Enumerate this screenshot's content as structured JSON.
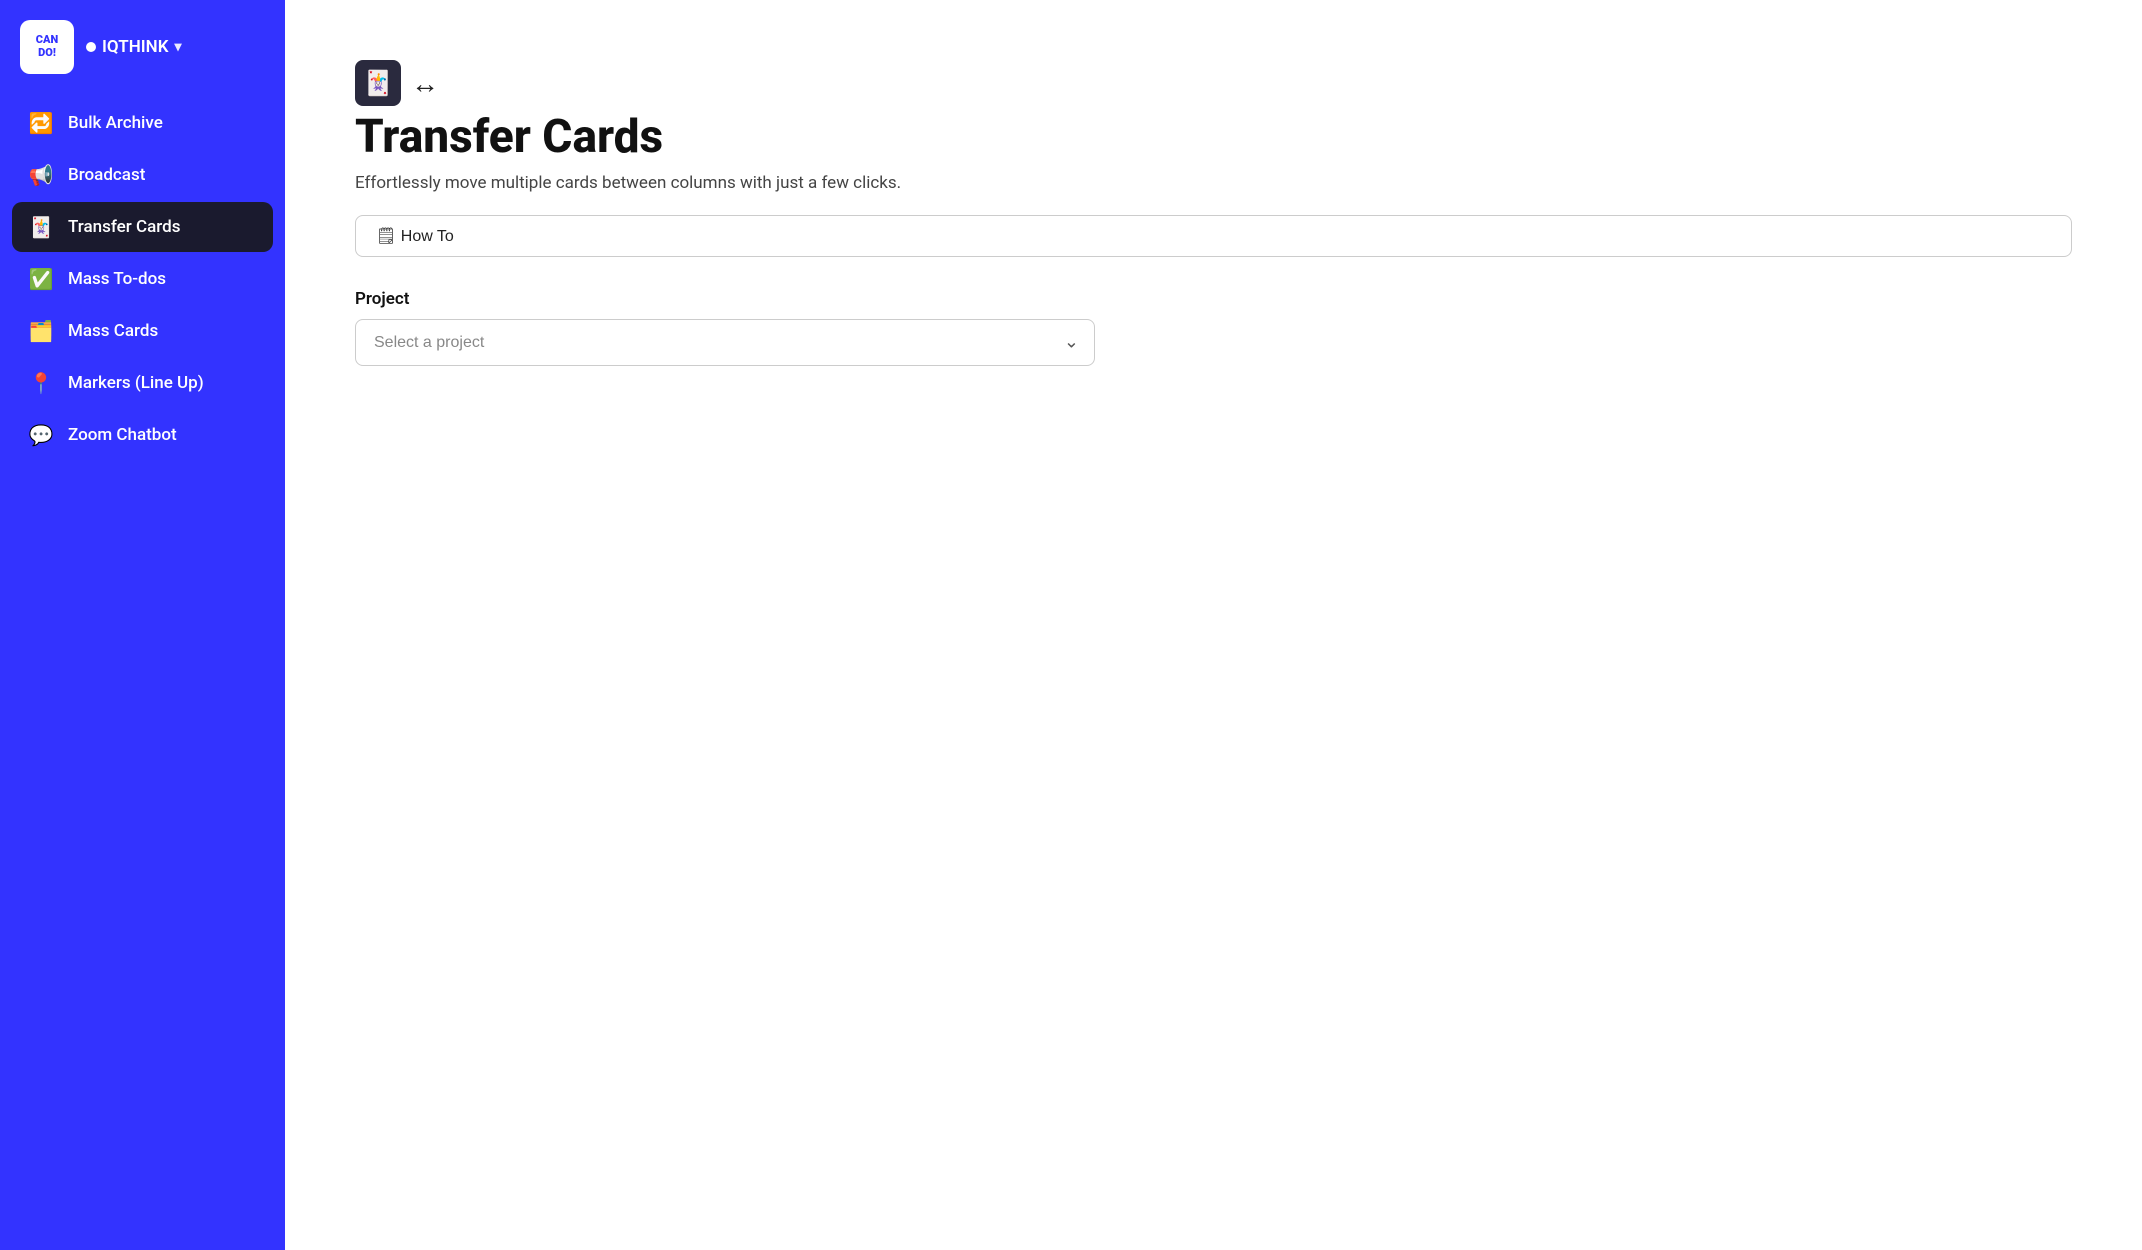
{
  "app": {
    "logo_text": "CAN\nDO!",
    "org_name": "IQTHINK",
    "org_dot_color": "#ffffff"
  },
  "sidebar": {
    "items": [
      {
        "id": "bulk-archive",
        "label": "Bulk Archive",
        "icon": "🔁",
        "active": false
      },
      {
        "id": "broadcast",
        "label": "Broadcast",
        "icon": "📢",
        "active": false
      },
      {
        "id": "transfer-cards",
        "label": "Transfer Cards",
        "icon": "🃏",
        "active": true
      },
      {
        "id": "mass-to-dos",
        "label": "Mass To-dos",
        "icon": "✅",
        "active": false
      },
      {
        "id": "mass-cards",
        "label": "Mass Cards",
        "icon": "🗂️",
        "active": false
      },
      {
        "id": "markers-lineup",
        "label": "Markers (Line Up)",
        "icon": "📍",
        "active": false
      },
      {
        "id": "zoom-chatbot",
        "label": "Zoom Chatbot",
        "icon": "💬",
        "active": false
      }
    ]
  },
  "main": {
    "page_title": "Transfer Cards",
    "page_subtitle": "Effortlessly move multiple cards between columns with just a few clicks.",
    "how_to_label": "🗒 How To",
    "project_section_label": "Project",
    "project_select_placeholder": "Select a project"
  }
}
